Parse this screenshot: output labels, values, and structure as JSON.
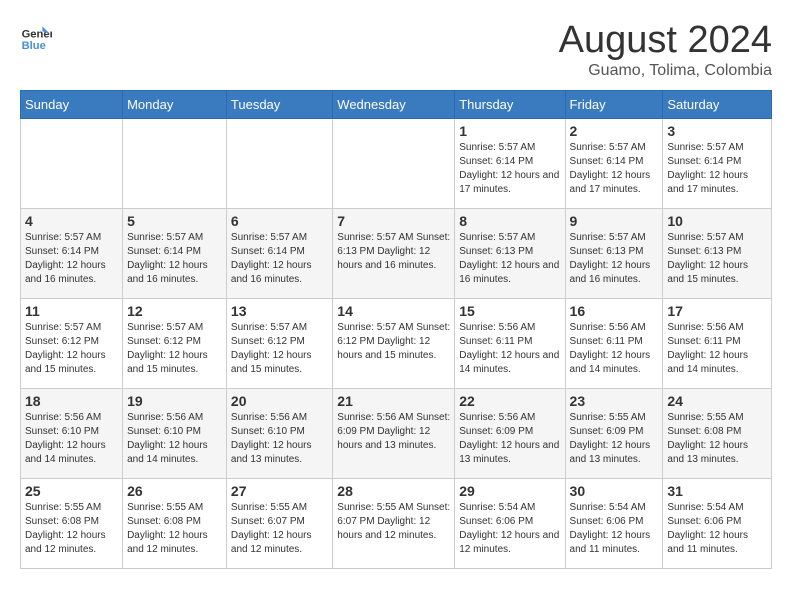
{
  "logo": {
    "line1": "General",
    "line2": "Blue"
  },
  "title": "August 2024",
  "subtitle": "Guamo, Tolima, Colombia",
  "days_of_week": [
    "Sunday",
    "Monday",
    "Tuesday",
    "Wednesday",
    "Thursday",
    "Friday",
    "Saturday"
  ],
  "weeks": [
    [
      {
        "day": "",
        "info": ""
      },
      {
        "day": "",
        "info": ""
      },
      {
        "day": "",
        "info": ""
      },
      {
        "day": "",
        "info": ""
      },
      {
        "day": "1",
        "info": "Sunrise: 5:57 AM\nSunset: 6:14 PM\nDaylight: 12 hours\nand 17 minutes."
      },
      {
        "day": "2",
        "info": "Sunrise: 5:57 AM\nSunset: 6:14 PM\nDaylight: 12 hours\nand 17 minutes."
      },
      {
        "day": "3",
        "info": "Sunrise: 5:57 AM\nSunset: 6:14 PM\nDaylight: 12 hours\nand 17 minutes."
      }
    ],
    [
      {
        "day": "4",
        "info": "Sunrise: 5:57 AM\nSunset: 6:14 PM\nDaylight: 12 hours\nand 16 minutes."
      },
      {
        "day": "5",
        "info": "Sunrise: 5:57 AM\nSunset: 6:14 PM\nDaylight: 12 hours\nand 16 minutes."
      },
      {
        "day": "6",
        "info": "Sunrise: 5:57 AM\nSunset: 6:14 PM\nDaylight: 12 hours\nand 16 minutes."
      },
      {
        "day": "7",
        "info": "Sunrise: 5:57 AM\nSunset: 6:13 PM\nDaylight: 12 hours\nand 16 minutes."
      },
      {
        "day": "8",
        "info": "Sunrise: 5:57 AM\nSunset: 6:13 PM\nDaylight: 12 hours\nand 16 minutes."
      },
      {
        "day": "9",
        "info": "Sunrise: 5:57 AM\nSunset: 6:13 PM\nDaylight: 12 hours\nand 16 minutes."
      },
      {
        "day": "10",
        "info": "Sunrise: 5:57 AM\nSunset: 6:13 PM\nDaylight: 12 hours\nand 15 minutes."
      }
    ],
    [
      {
        "day": "11",
        "info": "Sunrise: 5:57 AM\nSunset: 6:12 PM\nDaylight: 12 hours\nand 15 minutes."
      },
      {
        "day": "12",
        "info": "Sunrise: 5:57 AM\nSunset: 6:12 PM\nDaylight: 12 hours\nand 15 minutes."
      },
      {
        "day": "13",
        "info": "Sunrise: 5:57 AM\nSunset: 6:12 PM\nDaylight: 12 hours\nand 15 minutes."
      },
      {
        "day": "14",
        "info": "Sunrise: 5:57 AM\nSunset: 6:12 PM\nDaylight: 12 hours\nand 15 minutes."
      },
      {
        "day": "15",
        "info": "Sunrise: 5:56 AM\nSunset: 6:11 PM\nDaylight: 12 hours\nand 14 minutes."
      },
      {
        "day": "16",
        "info": "Sunrise: 5:56 AM\nSunset: 6:11 PM\nDaylight: 12 hours\nand 14 minutes."
      },
      {
        "day": "17",
        "info": "Sunrise: 5:56 AM\nSunset: 6:11 PM\nDaylight: 12 hours\nand 14 minutes."
      }
    ],
    [
      {
        "day": "18",
        "info": "Sunrise: 5:56 AM\nSunset: 6:10 PM\nDaylight: 12 hours\nand 14 minutes."
      },
      {
        "day": "19",
        "info": "Sunrise: 5:56 AM\nSunset: 6:10 PM\nDaylight: 12 hours\nand 14 minutes."
      },
      {
        "day": "20",
        "info": "Sunrise: 5:56 AM\nSunset: 6:10 PM\nDaylight: 12 hours\nand 13 minutes."
      },
      {
        "day": "21",
        "info": "Sunrise: 5:56 AM\nSunset: 6:09 PM\nDaylight: 12 hours\nand 13 minutes."
      },
      {
        "day": "22",
        "info": "Sunrise: 5:56 AM\nSunset: 6:09 PM\nDaylight: 12 hours\nand 13 minutes."
      },
      {
        "day": "23",
        "info": "Sunrise: 5:55 AM\nSunset: 6:09 PM\nDaylight: 12 hours\nand 13 minutes."
      },
      {
        "day": "24",
        "info": "Sunrise: 5:55 AM\nSunset: 6:08 PM\nDaylight: 12 hours\nand 13 minutes."
      }
    ],
    [
      {
        "day": "25",
        "info": "Sunrise: 5:55 AM\nSunset: 6:08 PM\nDaylight: 12 hours\nand 12 minutes."
      },
      {
        "day": "26",
        "info": "Sunrise: 5:55 AM\nSunset: 6:08 PM\nDaylight: 12 hours\nand 12 minutes."
      },
      {
        "day": "27",
        "info": "Sunrise: 5:55 AM\nSunset: 6:07 PM\nDaylight: 12 hours\nand 12 minutes."
      },
      {
        "day": "28",
        "info": "Sunrise: 5:55 AM\nSunset: 6:07 PM\nDaylight: 12 hours\nand 12 minutes."
      },
      {
        "day": "29",
        "info": "Sunrise: 5:54 AM\nSunset: 6:06 PM\nDaylight: 12 hours\nand 12 minutes."
      },
      {
        "day": "30",
        "info": "Sunrise: 5:54 AM\nSunset: 6:06 PM\nDaylight: 12 hours\nand 11 minutes."
      },
      {
        "day": "31",
        "info": "Sunrise: 5:54 AM\nSunset: 6:06 PM\nDaylight: 12 hours\nand 11 minutes."
      }
    ]
  ]
}
